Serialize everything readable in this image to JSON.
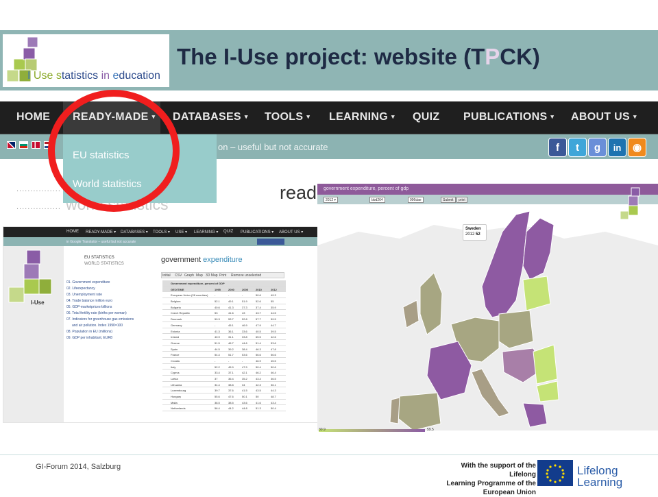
{
  "slide": {
    "title_prefix": "The I-Use project: website (T",
    "title_faded": "P",
    "title_suffix": "CK)",
    "footer": "GI-Forum 2014, Salzburg"
  },
  "logo": {
    "text_i": "I",
    "text_use": "Use ",
    "text_s": "s",
    "text_tat": "tatistics ",
    "text_in": "in ",
    "text_e": "e",
    "text_rest": "ducation",
    "cube_letters": "I-Use"
  },
  "nav": {
    "items": [
      {
        "label": "HOME",
        "caret": ""
      },
      {
        "label": "READY-MADE",
        "caret": "▾"
      },
      {
        "label": "DATABASES",
        "caret": "▾"
      },
      {
        "label": "TOOLS",
        "caret": "▾"
      },
      {
        "label": "LEARNING",
        "caret": "▾"
      },
      {
        "label": "QUIZ",
        "caret": ""
      },
      {
        "label": "PUBLICATIONS",
        "caret": "▾"
      },
      {
        "label": "ABOUT US",
        "caret": "▾"
      }
    ]
  },
  "strip": {
    "translation_note": "on – useful but not accurate",
    "share_buttons": [
      {
        "icon": "facebook-icon",
        "glyph": "f",
        "color": "#3b5998"
      },
      {
        "icon": "twitter-icon",
        "glyph": "t",
        "color": "#3fa6d9"
      },
      {
        "icon": "google-icon",
        "glyph": "g",
        "color": "#6a8fd8"
      },
      {
        "icon": "linkedin-icon",
        "glyph": "in",
        "color": "#1e73b0"
      },
      {
        "icon": "rss-icon",
        "glyph": "◉",
        "color": "#f08a1d"
      }
    ]
  },
  "dropdown": {
    "items": [
      "EU statistics",
      "World statistics"
    ]
  },
  "background": {
    "ready_text": "read",
    "world_text": "world statistics",
    "dots": "................"
  },
  "screenshot": {
    "nav": [
      "HOME",
      "READY-MADE ▾",
      "DATABASES ▾",
      "TOOLS ▾",
      "USE ▾",
      "LEARNING ▾",
      "QUIZ",
      "PUBLICATIONS ▾",
      "ABOUT US ▾"
    ],
    "strip_text": "in Google Translator – useful but not accurate",
    "cat1": "EU STATISTICS",
    "cat2": "WORLD STATISTICS",
    "list": [
      "01. Government expenditure",
      "02. Lifeexpectancy",
      "03. Unemployment rate",
      "04. Trade balance million euro",
      "05. GDP-marketprices-billions",
      "06. Total fertility rate (births per woman)",
      "07. Indicators for greenhouse gas emissions",
      "and air pollution. Index 1990=100",
      "08. Population in EU (millions)",
      "09. GDP per inhabitant, EUR8"
    ],
    "title_a": "government ",
    "title_b": "expenditure",
    "tabs": [
      "Initial",
      "CSV",
      "Graph",
      "Map",
      "3D Map",
      "Print",
      "Remove unselected"
    ],
    "table_caption": "Government expenditure, percent of GDP",
    "table_header": [
      "GEO/TIME",
      "1995",
      "2000",
      "2005",
      "2010",
      "2012"
    ],
    "table_rows": [
      [
        "European Union (28 countries)",
        "-",
        "-",
        "-",
        "50.6",
        "49.3"
      ],
      [
        "Belgium",
        "52.1",
        "49.1",
        "51.9",
        "52.6",
        "55"
      ],
      [
        "Bulgaria",
        "40.6",
        "41.3",
        "37.3",
        "37.4",
        "35.9"
      ],
      [
        "Czech Republic",
        "53",
        "41.6",
        "43",
        "43.7",
        "44.5"
      ],
      [
        "Denmark",
        "59.3",
        "53.7",
        "52.8",
        "57.7",
        "59.5"
      ],
      [
        "Germany",
        "-",
        "45.1",
        "46.9",
        "47.9",
        "44.7"
      ],
      [
        "Estonia",
        "41.3",
        "36.1",
        "33.6",
        "40.5",
        "39.5"
      ],
      [
        "Ireland",
        "40.9",
        "31.1",
        "33.8",
        "65.5",
        "42.6"
      ],
      [
        "Greece",
        "51.5",
        "46.7",
        "44.6",
        "51.4",
        "53.6"
      ],
      [
        "Spain",
        "44.5",
        "39.2",
        "38.4",
        "46.3",
        "47.8"
      ],
      [
        "France",
        "54.4",
        "51.7",
        "53.6",
        "56.6",
        "56.6"
      ],
      [
        "Croatia",
        "-",
        "-",
        "-",
        "46.9",
        "45.5"
      ],
      [
        "Italy",
        "52.2",
        "45.9",
        "47.9",
        "50.4",
        "50.6"
      ],
      [
        "Cyprus",
        "33.4",
        "37.1",
        "42.1",
        "46.2",
        "46.4"
      ],
      [
        "Latvia",
        "37",
        "36.4",
        "35.2",
        "43.4",
        "36.5"
      ],
      [
        "Lithuania",
        "34.4",
        "38.8",
        "34",
        "42.3",
        "36.1"
      ],
      [
        "Luxembourg",
        "39.7",
        "37.6",
        "41.5",
        "43.5",
        "44.3"
      ],
      [
        "Hungary",
        "55.6",
        "47.6",
        "50.1",
        "50",
        "48.7"
      ],
      [
        "Malta",
        "38.5",
        "38.5",
        "43.6",
        "41.6",
        "43.4"
      ],
      [
        "Netherlands",
        "56.4",
        "44.2",
        "44.8",
        "51.3",
        "50.4"
      ]
    ]
  },
  "map": {
    "header": "government expenditure, percent of gdp",
    "year_select": "2012",
    "color_a": "bbd264",
    "color_b": "996dae",
    "submit": "Submit",
    "print": "print",
    "tooltip_country": "Sweden",
    "tooltip_year": "2012",
    "tooltip_value": "52",
    "legend_min": "30.9",
    "legend_max": "59.5",
    "colors": {
      "high": "#8e5aa2",
      "mid_high": "#a87fa8",
      "mid": "#a7a682",
      "low": "#c5e376",
      "land": "#eaeaea"
    }
  },
  "eu": {
    "support_line1": "With the support of the Lifelong",
    "support_line2": "Learning Programme of the",
    "support_line3": "European Union",
    "ll_line1": "Lifelong",
    "ll_line2": "Learning"
  }
}
